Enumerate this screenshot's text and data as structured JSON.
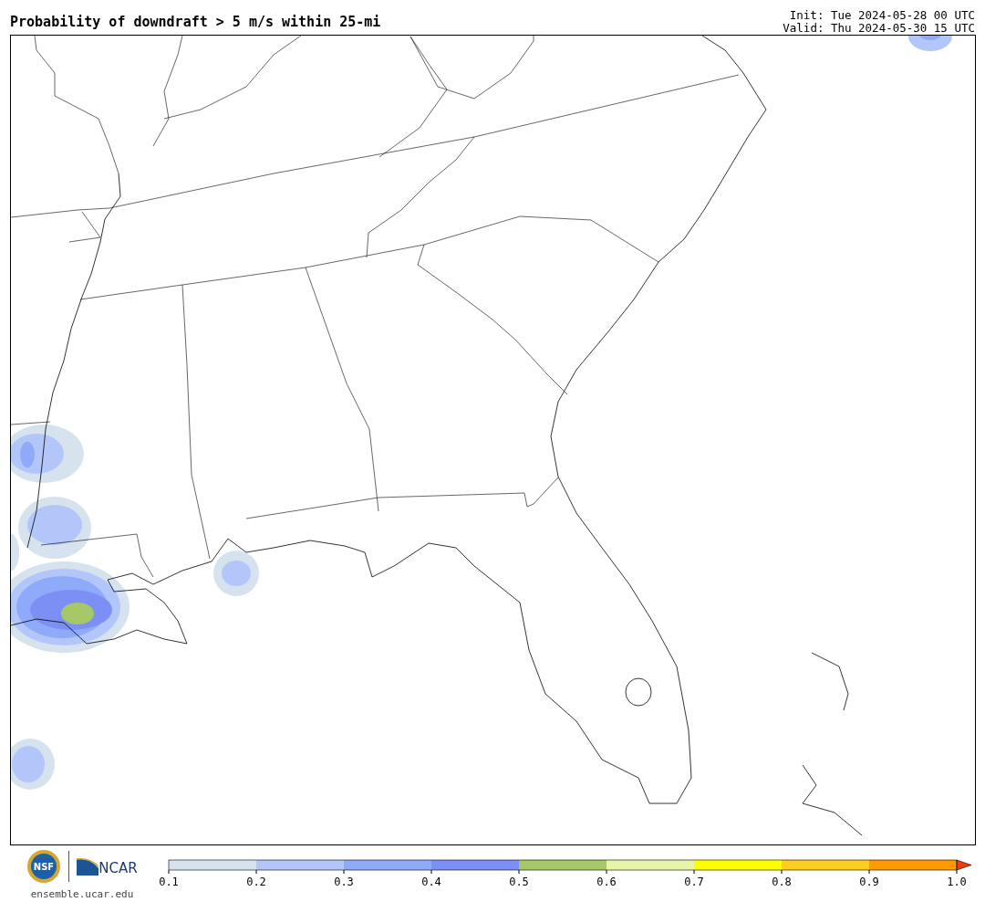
{
  "title": "Probability of downdraft > 5 m/s within 25-mi",
  "init": "Init: Tue 2024-05-28 00 UTC",
  "valid": "Valid: Thu 2024-05-30 15 UTC",
  "colorbar": {
    "bins": [
      {
        "color": "#d6e2ee"
      },
      {
        "color": "#b3c6fa"
      },
      {
        "color": "#8eaaf8"
      },
      {
        "color": "#7b8ff5"
      },
      {
        "color": "#a6c866"
      },
      {
        "color": "#e6f5a8"
      },
      {
        "color": "#ffff00"
      },
      {
        "color": "#ffcc22"
      },
      {
        "color": "#ff9a00"
      }
    ],
    "extension": {
      "color": "#e84010"
    },
    "ticks": [
      "0.1",
      "0.2",
      "0.3",
      "0.4",
      "0.5",
      "0.6",
      "0.7",
      "0.8",
      "0.9",
      "1.0"
    ]
  },
  "footer": {
    "seal_text": "NSF",
    "logo_text": "NCAR",
    "website": "ensemble.ucar.edu"
  }
}
